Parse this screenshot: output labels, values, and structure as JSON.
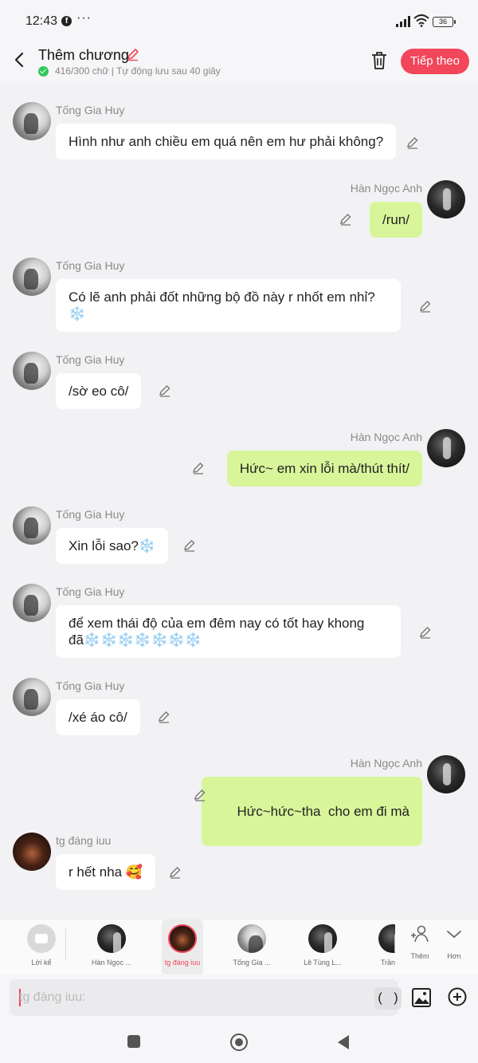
{
  "status_bar": {
    "time": "12:43",
    "battery": "36",
    "more": "···",
    "facebook_glyph": "f"
  },
  "header": {
    "title": "Thêm chương",
    "subtitle": "416/300 chữ | Tự động lưu sau 40 giây",
    "next_label": "Tiếp theo",
    "accent_color": "#f2465b"
  },
  "messages": [
    {
      "sender": "Tống Gia Huy",
      "text": "Hình như anh chiều em quá nên em hư phải không?",
      "me": false
    },
    {
      "sender": "Hàn Ngọc Anh",
      "text": "/run/",
      "me": true
    },
    {
      "sender": "Tống Gia Huy",
      "text": "Có lẽ anh phải đốt những bộ đồ này r nhốt em nhỉ?",
      "text2": "❄️",
      "me": false
    },
    {
      "sender": "Tống Gia Huy",
      "text": "/sờ eo cô/",
      "me": false
    },
    {
      "sender": "Hàn Ngọc Anh",
      "text": "Hức~ em xin lỗi mà/thút thít/",
      "me": true
    },
    {
      "sender": "Tống Gia Huy",
      "text": "Xin lỗi sao?❄️",
      "me": false
    },
    {
      "sender": "Tống Gia Huy",
      "text": "để xem thái độ của em đêm nay có tốt hay khong",
      "text2": "đã❄️❄️❄️❄️❄️❄️❄️",
      "me": false
    },
    {
      "sender": "Tống Gia Huy",
      "text": "/xé áo cô/",
      "me": false
    },
    {
      "sender": "Hàn Ngọc Anh",
      "text": "Hức~hức~tha  cho em đi mà",
      "me": true
    },
    {
      "sender": "tg đáng iuu",
      "text": "r hết nha 🥰",
      "me": false
    }
  ],
  "character_bar": {
    "narrator": "Lời kể",
    "characters": [
      "Hàn Ngọc ...",
      "tg đáng iuu",
      "Tống Gia ...",
      "Lê Tùng L...",
      "Trần"
    ],
    "add_label": "Thêm",
    "more_label": "Hơn"
  },
  "composer": {
    "placeholder": "tg đáng iuu:",
    "paren": "( )"
  }
}
